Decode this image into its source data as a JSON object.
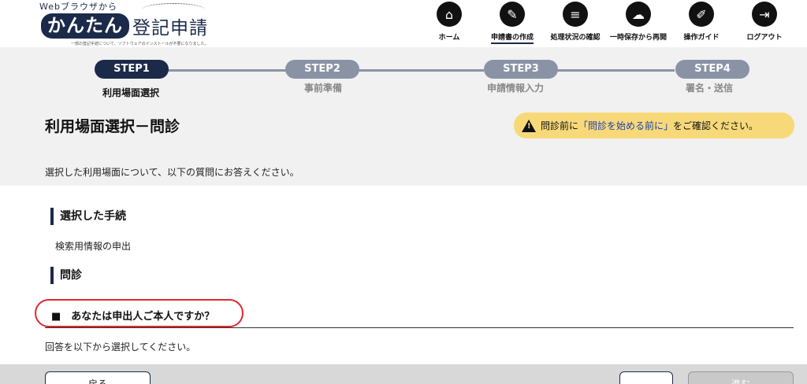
{
  "header": {
    "logo_top": "Webブラウザから",
    "logo_kanatan": "かんたん",
    "logo_title": "登記申請",
    "logo_sub": "一部の登記手続について、ソフトウェアのインストールが不要になりました。",
    "nav": [
      {
        "label": "ホーム",
        "icon": "home-icon",
        "glyph": "⌂"
      },
      {
        "label": "申請書の作成",
        "icon": "edit-document-icon",
        "glyph": "✎"
      },
      {
        "label": "処理状況の確認",
        "icon": "status-list-icon",
        "glyph": "≡"
      },
      {
        "label": "一時保存から再開",
        "icon": "cloud-download-icon",
        "glyph": "☁"
      },
      {
        "label": "操作ガイド",
        "icon": "guide-book-icon",
        "glyph": "✐"
      },
      {
        "label": "ログアウト",
        "icon": "logout-icon",
        "glyph": "⇥"
      }
    ]
  },
  "steps": [
    {
      "pill": "STEP1",
      "label": "利用場面選択"
    },
    {
      "pill": "STEP2",
      "label": "事前準備"
    },
    {
      "pill": "STEP3",
      "label": "申請情報入力"
    },
    {
      "pill": "STEP4",
      "label": "署名・送信"
    }
  ],
  "page": {
    "title": "利用場面選択－問診",
    "notice_pre": "問診前に",
    "notice_link": "「問診を始める前に」",
    "notice_post": "をご確認ください。",
    "intro": "選択した利用場面について、以下の質問にお答えください。"
  },
  "content": {
    "selected_heading": "選択した手続",
    "procedure": "検索用情報の申出",
    "interview_heading": "問診",
    "question": "■　あなたは申出人ご本人ですか？",
    "answer_hint": "回答を以下から選択してください。"
  },
  "footer": {
    "back_label": "戻る",
    "next_label": "進む"
  }
}
